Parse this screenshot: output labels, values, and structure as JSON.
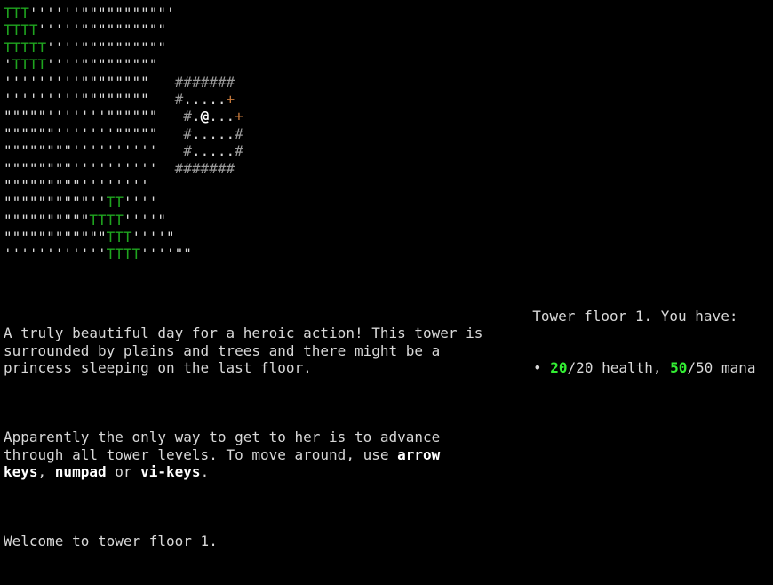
{
  "map": {
    "rows": [
      "TTT''''''\"\"\"\"\"\"\"\"\"\"'",
      "TTTT'''''\"\"\"\"\"\"\"\"\"\"",
      "TTTTT''''\"\"\"\"\"\"\"\"\"\"",
      "'TTTT''''\"\"\"\"\"\"\"\"\"",
      "'''''''''\"\"\"\"\"\"\"\"   #######",
      "'''''''''\"\"\"\"\"\"\"\"   #.....+",
      "\"\"\"\"\"'''''''\"\"\"\"\"\"   #.@...+",
      "\"\"\"\"\"\"'''''''\"\"\"\"\"   #.....#",
      "\"\"\"\"\"\"\"\"''''''''''   #.....#",
      "\"\"\"\"\"\"\"\"''''''''''  #######",
      "\"\"\"\"\"\"\"\"\"''''''''",
      "\"\"\"\"\"\"\"\"\"\"''TT''''",
      "\"\"\"\"\"\"\"\"\"\"TTTT''''\"",
      "\"\"\"\"\"\"\"\"\"\"\"\"TTT''''\"",
      "''''''''''''TTTT''''\"\""
    ]
  },
  "story": {
    "intro": "A truly beautiful day for a heroic action! This tower is surrounded by plains and trees and there might be a princess sleeping on the last floor.",
    "how_to_pre": "Apparently the only way to get to her is to advance through all tower levels. To move around, use ",
    "key1": "arrow keys",
    "sep1": ", ",
    "key2": "numpad",
    "sep2": " or ",
    "key3": "vi-keys",
    "end": ".",
    "welcome": "Welcome to tower floor 1."
  },
  "status": {
    "header": "Tower floor 1. You have:",
    "bullet": "•",
    "health_current": "20",
    "health_rest": "/20 health, ",
    "mana_current": "50",
    "mana_rest": "/50 mana"
  },
  "colors": {
    "tree": "#1fa51f",
    "grass": "#dcdcdc",
    "wall": "#9a9a9a",
    "door": "#c87a3c",
    "player": "#ffffff",
    "highlight_number": "#33ee33",
    "background": "#000000"
  }
}
